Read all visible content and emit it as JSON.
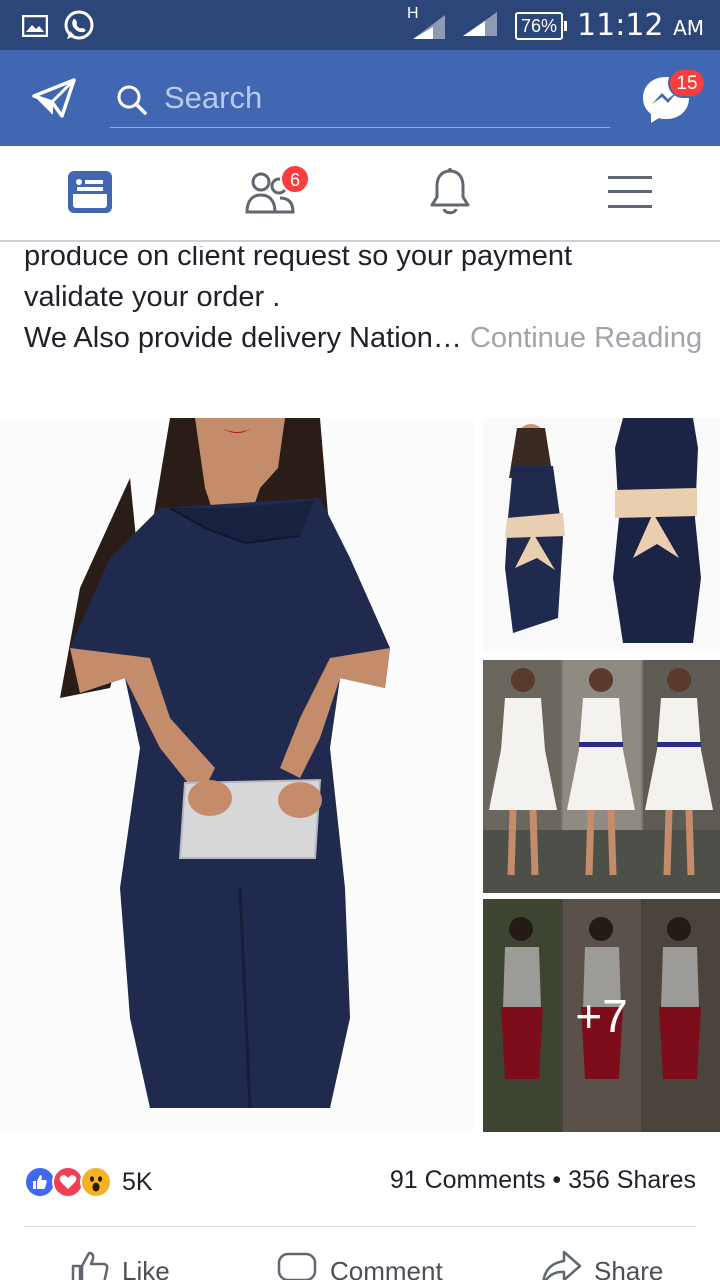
{
  "status_bar": {
    "network": "H",
    "battery": "76%",
    "time": "11:12",
    "ampm": "AM"
  },
  "app_bar": {
    "search_placeholder": "Search",
    "messenger_badge": "15"
  },
  "tabs": {
    "friends_badge": "6"
  },
  "post": {
    "text_line1": "produce on client request so your payment",
    "text_line2": "validate your order .",
    "text_line3": "We Also provide delivery Nation…",
    "continue_label": "Continue Reading",
    "more_photos": "+7"
  },
  "engagement": {
    "reactions_count": "5K",
    "comments": "91 Comments",
    "separator": "•",
    "shares": "356 Shares"
  },
  "actions": {
    "like": "Like",
    "comment": "Comment",
    "share": "Share"
  },
  "colors": {
    "status_bar": "#2d4679",
    "app_bar": "#4267b2",
    "badge": "#fa3e3e",
    "dress_navy": "#1f2a4e",
    "link_grey": "#a0a4ab"
  }
}
